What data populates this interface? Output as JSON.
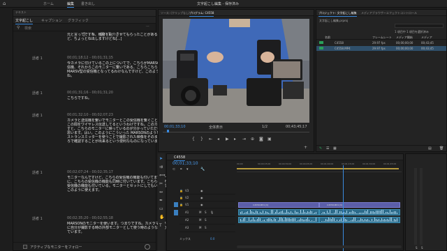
{
  "app": {
    "workspace_tabs": [
      "ホーム",
      "編集",
      "書き出し"
    ],
    "active_tab_index": 1,
    "window_title": "文字起こし編集 - 保存済み"
  },
  "transcript": {
    "tabs": [
      "テキスト",
      "文字起こし",
      "キャプション",
      "グラフィック"
    ],
    "search_placeholder": "検索",
    "entries": [
      {
        "speaker": "",
        "timecode": "",
        "text": "元と言ってですね、機材を紹介させてもらったことがあるんですけど、ちょっとね出しますけどね[...]"
      },
      {
        "speaker": "話者 1",
        "timecode": "00;01;18;12 - 00;01;31;15",
        "text": "今カメラに付けているこの上についてで、こちらがMARSON社の送信機、それからこのモニターに繋いである、こちらこちら側がMARSV型の受信機となってるわけなんですけど、このようにですね。"
      },
      {
        "speaker": "話者 1",
        "timecode": "00;01;31;16 - 00;01;31;20",
        "text": "こちらですね。"
      },
      {
        "speaker": "話者 1",
        "timecode": "00;01;32;10 - 00;02;07;23",
        "text": "カメラと送信機を繋いでモニターとこの受信機を繋ぐことによって、この間をワイヤレス伝送してるというわけですね。このカメラを動かすと、こちらのモニターに映っているのが分かっていただけるかなと思います。はい。このようにこういった MARSONのようなワイヤレストランスミッターを使うことで撮影された映像をそのまま別のところで確認することが出来るという便利なものになっています。"
      },
      {
        "speaker": "話者 1",
        "timecode": "00;02;07;24 - 00;02;35;17",
        "text": "モニターなんですけど、こちらの受信機の機能も付いてます。一度に、こちらの受信機の機能も同時に付いています。こちらもこちらの受信機の機能も付いている。モニターとセットにしてもいいですし、このように使えます。"
      },
      {
        "speaker": "話者 1",
        "timecode": "00;02;35;20 - 00;02;55;18",
        "text": "MARSONのモニターを使います。つまりですね。カメラマンが画面に自分が撮影する時の外部モニターとして使う時のような使い方をしています。"
      }
    ],
    "footer_follow_label": "アクティブなモニターをフォロー"
  },
  "program": {
    "tabs": [
      "ソース: (クリップなし)",
      "プログラム: C4558"
    ],
    "timecode": "00;01;33;10",
    "fit": "全体表示",
    "scale": "1/2",
    "duration": "00;43;45;17"
  },
  "project": {
    "tabs": [
      "プロジェクト: 文字起こし編集",
      "メディアブラウザー",
      "エフェクトコントロール"
    ],
    "path": "文字起こし編集.prproj",
    "selection_info": "1 項目中 1 項目を選択済み",
    "columns": [
      "名前",
      "フレームレート",
      "メディア開始",
      "メディア"
    ],
    "items": [
      {
        "name": "C4558",
        "fps": "29.97 fps",
        "start": "00;00;00;00",
        "dur": "00;43;45"
      },
      {
        "name": "C4558.MP4",
        "fps": "29.97 fps",
        "start": "00;00;00;00",
        "dur": "00;43;45"
      }
    ]
  },
  "timeline": {
    "sequence_name": "C4558",
    "timecode": "00;01;33;10",
    "ruler": [
      "00;00",
      "00;00;15;00",
      "00;00;30;00",
      "00;00;45;00",
      "00;01;00;00",
      "00;01;15;00",
      "00;01;30;00",
      "00;01;45;00"
    ],
    "video_tracks": [
      "V3",
      "V2",
      "V1"
    ],
    "audio_tracks": [
      "A1",
      "A2",
      "A3"
    ],
    "mix_label": "ミックス",
    "mix_value": "0.0",
    "clip_name": "C4558.MP4 [V]"
  },
  "colors": {
    "accent": "#3a8be0",
    "video_clip": "#5b5ea8",
    "audio_clip": "#2d6b8a",
    "playhead": "#3a8be0",
    "green_label": "#2aa05a"
  }
}
